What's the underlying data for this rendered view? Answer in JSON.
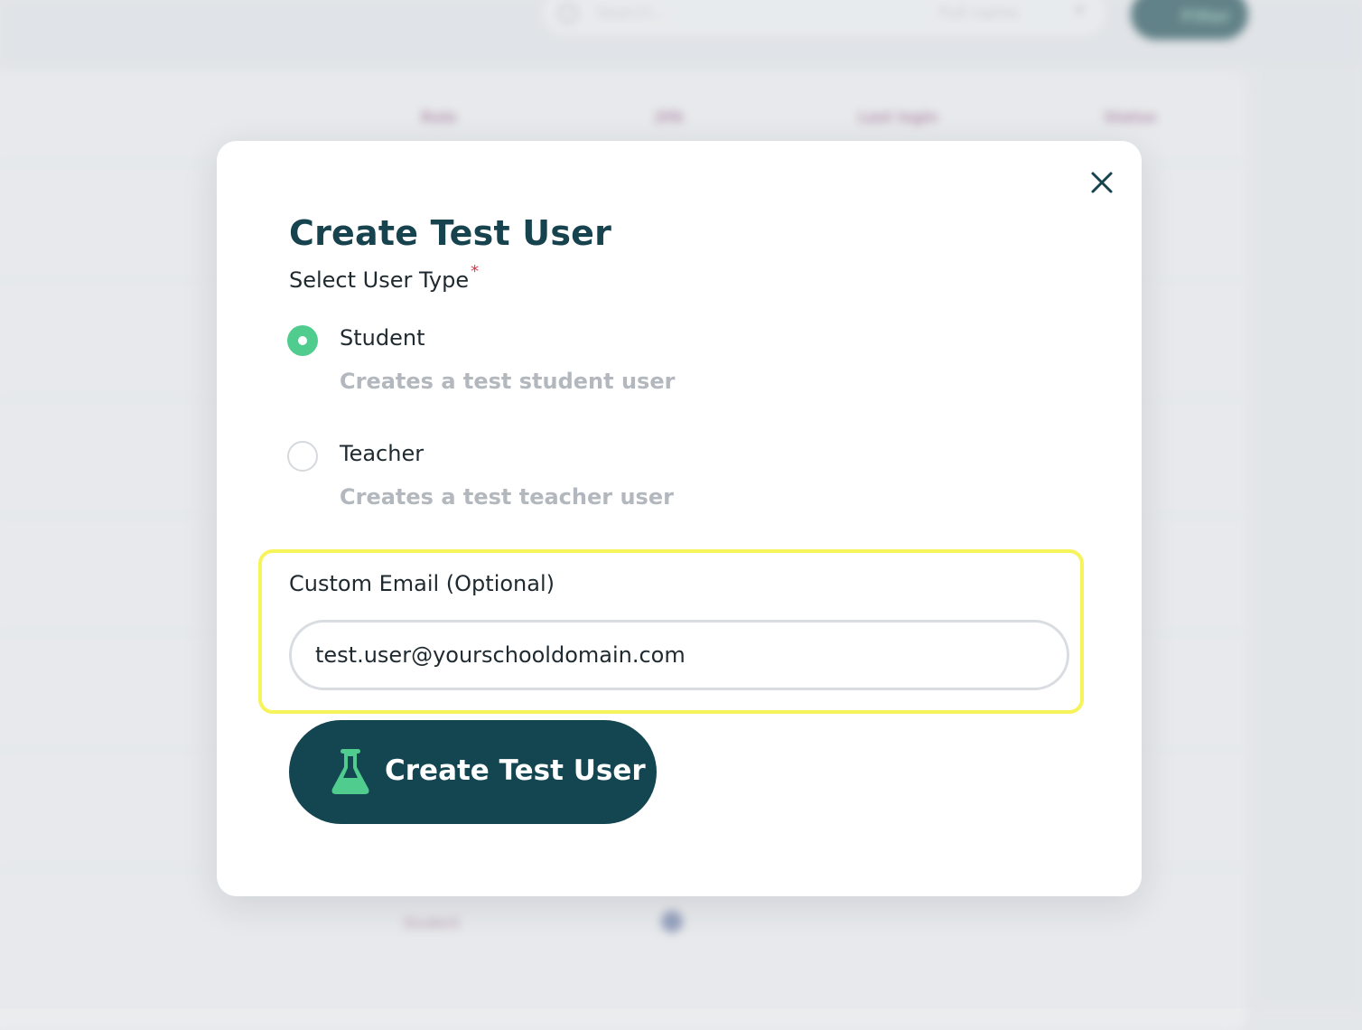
{
  "background": {
    "search": {
      "placeholder": "Search...",
      "filter_select": "Full name"
    },
    "filter_button": "Filter",
    "table_headers": [
      "Role",
      "2FA",
      "Last login",
      "Status"
    ],
    "partial_row_role": "Student"
  },
  "modal": {
    "title": "Create Test User",
    "user_type_label": "Select User Type",
    "required_mark": "*",
    "options": [
      {
        "label": "Student",
        "description": "Creates a test student user",
        "selected": true
      },
      {
        "label": "Teacher",
        "description": "Creates a test teacher user",
        "selected": false
      }
    ],
    "email": {
      "label": "Custom Email (Optional)",
      "value": "test.user@yourschooldomain.com"
    },
    "submit_label": "Create Test User"
  },
  "colors": {
    "primary": "#144652",
    "accent": "#4fcc8e",
    "highlight": "#f7f35a",
    "required": "#d0354a"
  },
  "icons": [
    "search-icon",
    "chevron-down-icon",
    "filter-icon",
    "close-icon",
    "flask-icon"
  ]
}
